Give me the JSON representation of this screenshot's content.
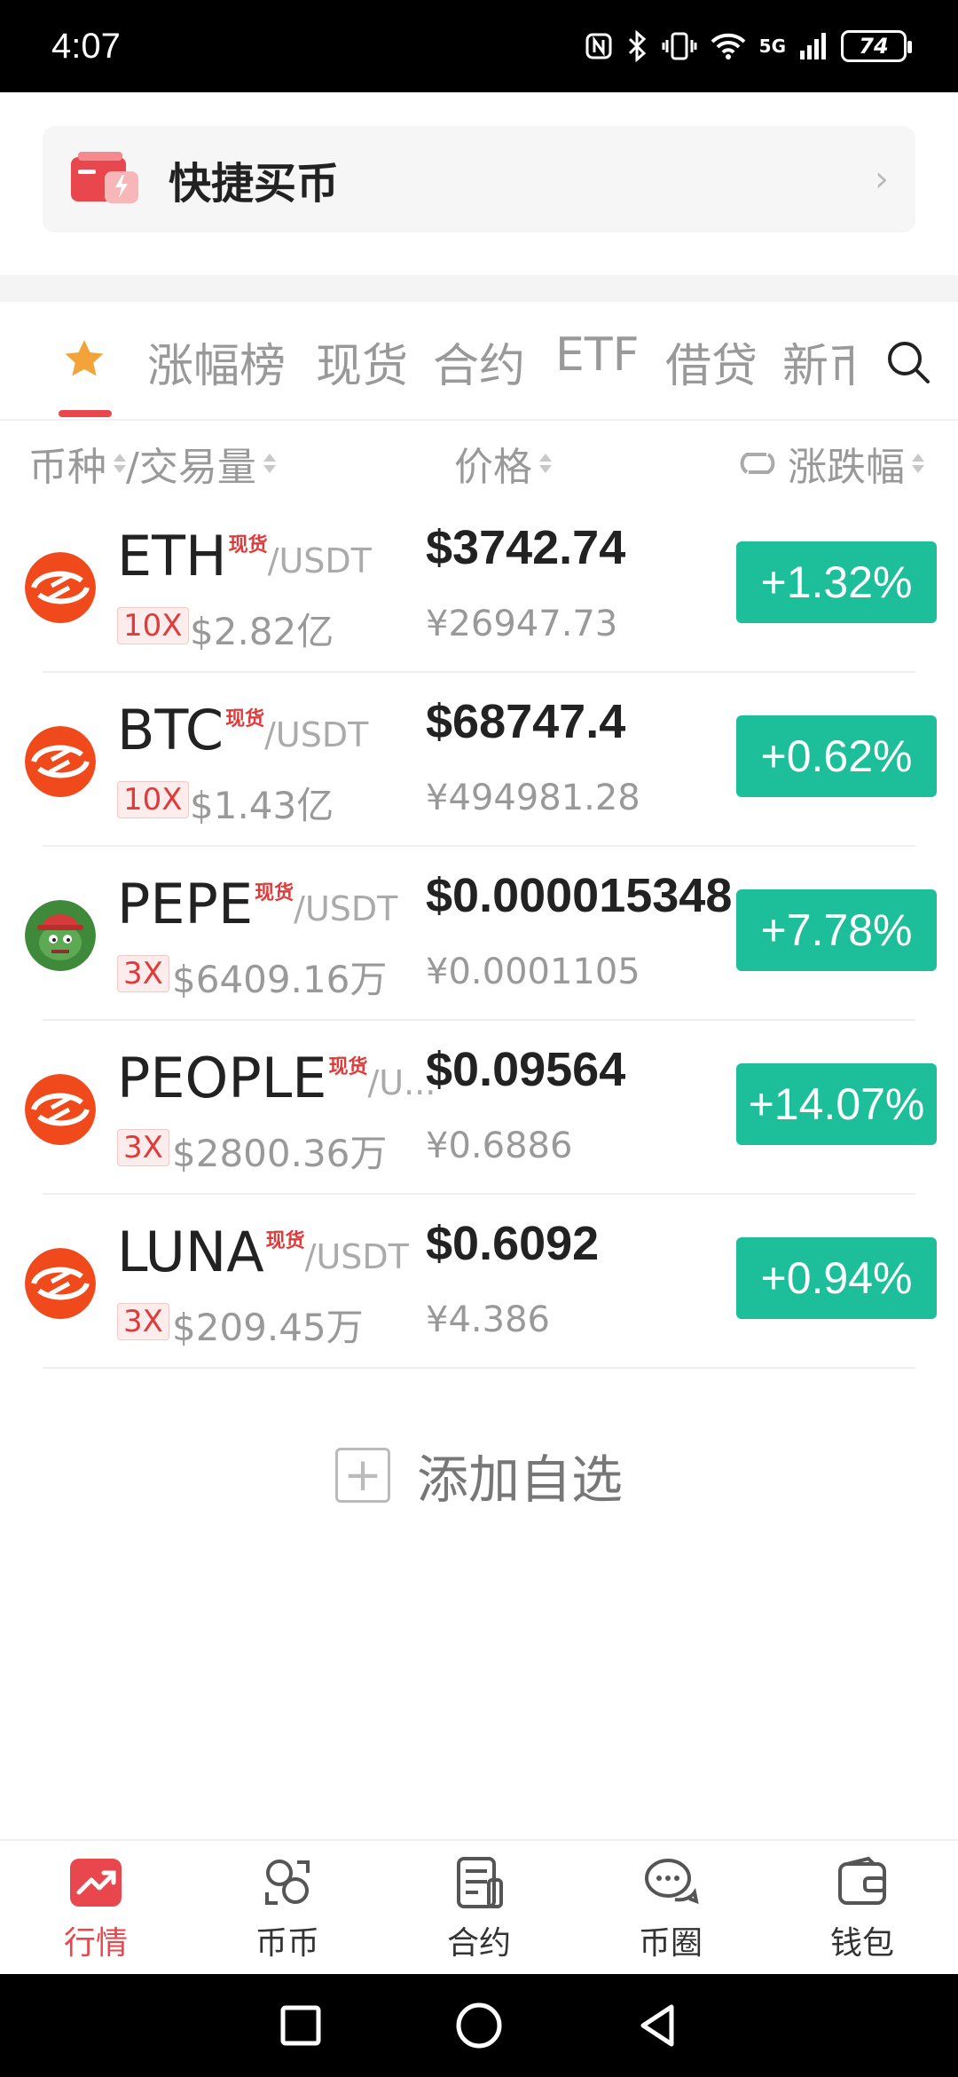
{
  "status": {
    "time": "4:07",
    "signal": "5G",
    "battery": "74"
  },
  "quick_buy": {
    "title": "快捷买币"
  },
  "tabs": [
    "涨幅榜",
    "现货",
    "合约",
    "ETF",
    "借贷",
    "新币"
  ],
  "headers": {
    "coin": "币种",
    "volume": "/交易量",
    "price": "价格",
    "change": "涨跌幅"
  },
  "colors": {
    "up": "#1dbf9a",
    "accent": "#e8474d",
    "spot_tag": "#e03b3b"
  },
  "rows": [
    {
      "symbol": "ETH",
      "tag": "现货",
      "quote": "/USDT",
      "leverage": "10X",
      "volume": "$2.82亿",
      "price": "$3742.74",
      "cny": "¥26947.73",
      "change": "+1.32%",
      "logo": "swap-logo"
    },
    {
      "symbol": "BTC",
      "tag": "现货",
      "quote": "/USDT",
      "leverage": "10X",
      "volume": "$1.43亿",
      "price": "$68747.4",
      "cny": "¥494981.28",
      "change": "+0.62%",
      "logo": "swap-logo"
    },
    {
      "symbol": "PEPE",
      "tag": "现货",
      "quote": "/USDT",
      "leverage": "3X",
      "volume": "$6409.16万",
      "price": "$0.000015348",
      "cny": "¥0.0001105",
      "change": "+7.78%",
      "logo": "pepe-logo"
    },
    {
      "symbol": "PEOPLE",
      "tag": "现货",
      "quote": "/U...",
      "leverage": "3X",
      "volume": "$2800.36万",
      "price": "$0.09564",
      "cny": "¥0.6886",
      "change": "+14.07%",
      "logo": "swap-logo"
    },
    {
      "symbol": "LUNA",
      "tag": "现货",
      "quote": "/USDT",
      "leverage": "3X",
      "volume": "$209.45万",
      "price": "$0.6092",
      "cny": "¥4.386",
      "change": "+0.94%",
      "logo": "swap-logo"
    }
  ],
  "add_favorite": {
    "label": "添加自选"
  },
  "nav": [
    {
      "label": "行情",
      "icon": "market-chart-icon",
      "active": true
    },
    {
      "label": "币币",
      "icon": "exchange-icon",
      "active": false
    },
    {
      "label": "合约",
      "icon": "contract-doc-icon",
      "active": false
    },
    {
      "label": "币圈",
      "icon": "chat-bubbles-icon",
      "active": false
    },
    {
      "label": "钱包",
      "icon": "wallet-icon",
      "active": false
    }
  ]
}
